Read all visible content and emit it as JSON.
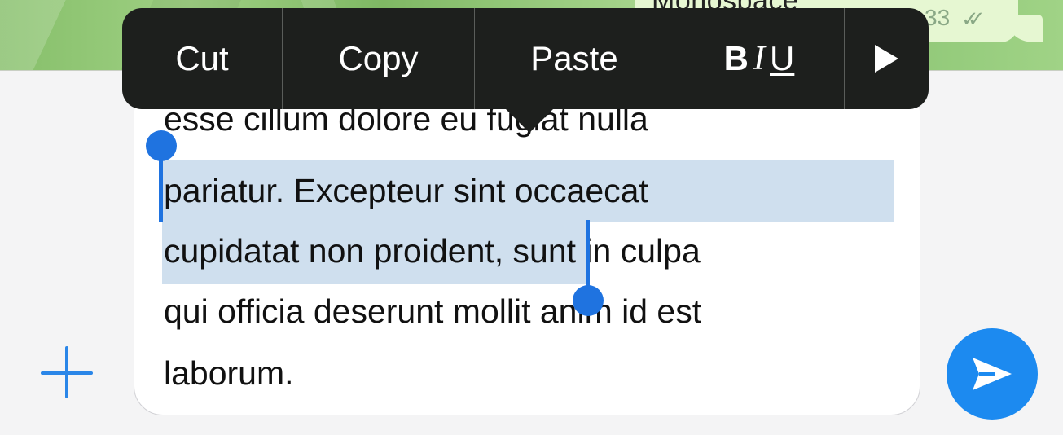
{
  "chat": {
    "bubble_text": "Monospace",
    "bubble_time": "33",
    "bubble_checks": "✓✓"
  },
  "edit_menu": {
    "cut": "Cut",
    "copy": "Copy",
    "paste": "Paste",
    "bold": "B",
    "italic": "I",
    "underline": "U",
    "more_icon": "play-triangle-icon"
  },
  "composer": {
    "lines": [
      "esse cillum dolore eu fugiat nulla",
      "pariatur. Excepteur sint occaecat",
      "cupidatat non proident, sunt in culpa",
      "qui officia deserunt mollit anim id est",
      "laborum."
    ],
    "selected_text": "pariatur. Excepteur sint occaecat cupidatat non proident,",
    "attach_icon": "plus-icon",
    "send_icon": "paper-plane-icon",
    "accent_color": "#1c8af0",
    "selection_color": "#cfdfee"
  }
}
